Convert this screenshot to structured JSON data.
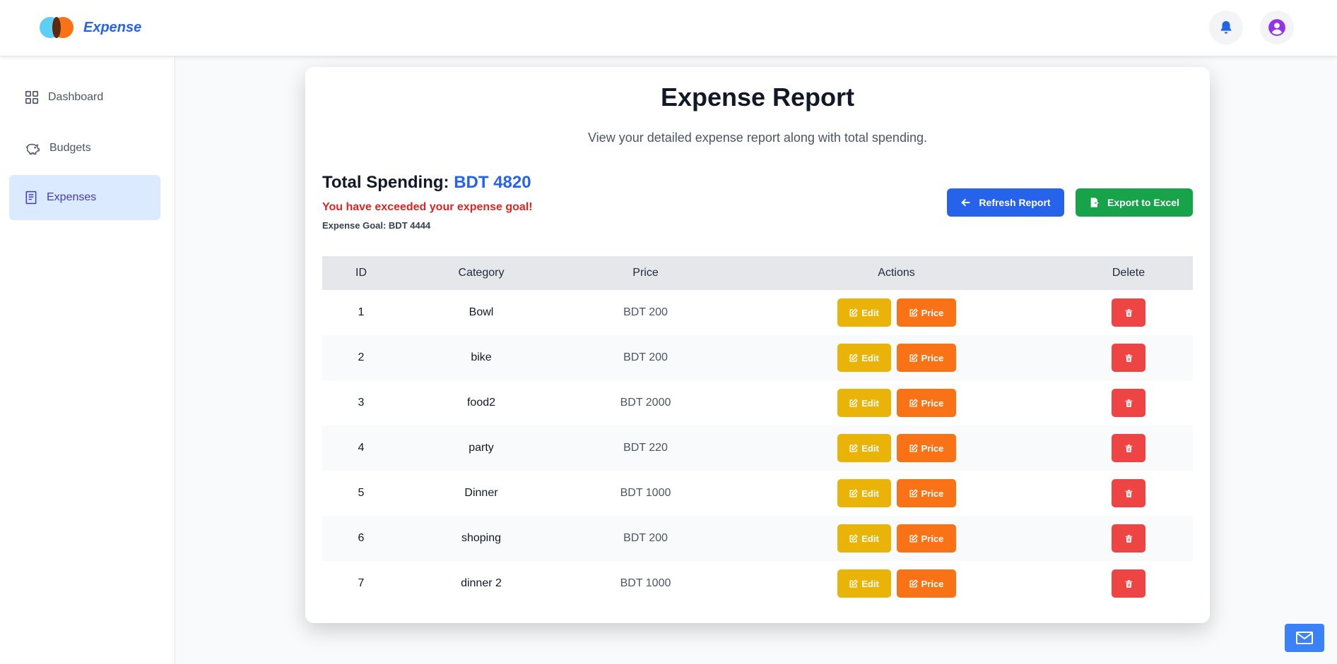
{
  "app": {
    "name": "Expense"
  },
  "sidebar": {
    "items": [
      {
        "label": "Dashboard",
        "icon": "grid-icon"
      },
      {
        "label": "Budgets",
        "icon": "piggy-bank-icon"
      },
      {
        "label": "Expenses",
        "icon": "receipt-icon",
        "active": true
      }
    ]
  },
  "report": {
    "title": "Expense Report",
    "subtitle": "View your detailed expense report along with total spending.",
    "total_label": "Total Spending:",
    "total_value": "BDT 4820",
    "warning": "You have exceeded your expense goal!",
    "goal": "Expense Goal: BDT 4444",
    "refresh_label": "Refresh Report",
    "export_label": "Export to Excel"
  },
  "table": {
    "headers": [
      "ID",
      "Category",
      "Price",
      "Actions",
      "Delete"
    ],
    "edit_label": "Edit",
    "price_label": "Price",
    "rows": [
      {
        "id": "1",
        "category": "Bowl",
        "price": "BDT 200"
      },
      {
        "id": "2",
        "category": "bike",
        "price": "BDT 200"
      },
      {
        "id": "3",
        "category": "food2",
        "price": "BDT 2000"
      },
      {
        "id": "4",
        "category": "party",
        "price": "BDT 220"
      },
      {
        "id": "5",
        "category": "Dinner",
        "price": "BDT 1000"
      },
      {
        "id": "6",
        "category": "shoping",
        "price": "BDT 200"
      },
      {
        "id": "7",
        "category": "dinner 2",
        "price": "BDT 1000"
      }
    ]
  },
  "colors": {
    "primary": "#2563eb",
    "success": "#16a34a",
    "warning": "#eab308",
    "orange": "#f97316",
    "danger": "#ef4444"
  }
}
